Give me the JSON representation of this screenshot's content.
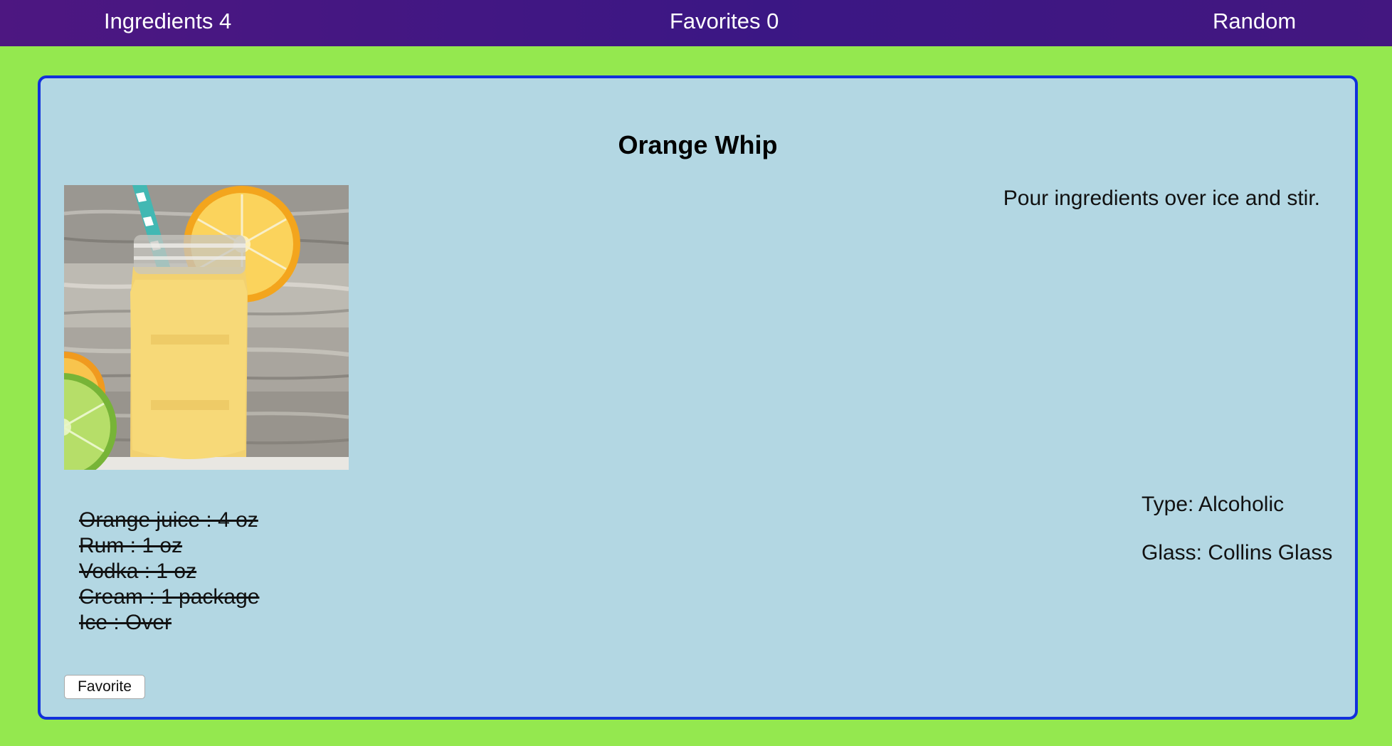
{
  "nav": {
    "ingredients": "Ingredients 4",
    "favorites": "Favorites 0",
    "random": "Random"
  },
  "drink": {
    "name": "Orange Whip",
    "instructions": "Pour ingredients over ice and stir.",
    "ingredients": [
      "Orange juice : 4 oz",
      "Rum : 1 oz",
      "Vodka : 1 oz",
      "Cream : 1 package",
      "Ice : Over"
    ],
    "type": "Type: Alcoholic",
    "glass": "Glass: Collins Glass",
    "image_icon": "drink-photo"
  },
  "actions": {
    "favorite_label": "Favorite"
  },
  "colors": {
    "page_background": "#94e84f",
    "topbar": "#45177f",
    "card_background": "#b3d7e3",
    "card_border": "#1230dc"
  }
}
